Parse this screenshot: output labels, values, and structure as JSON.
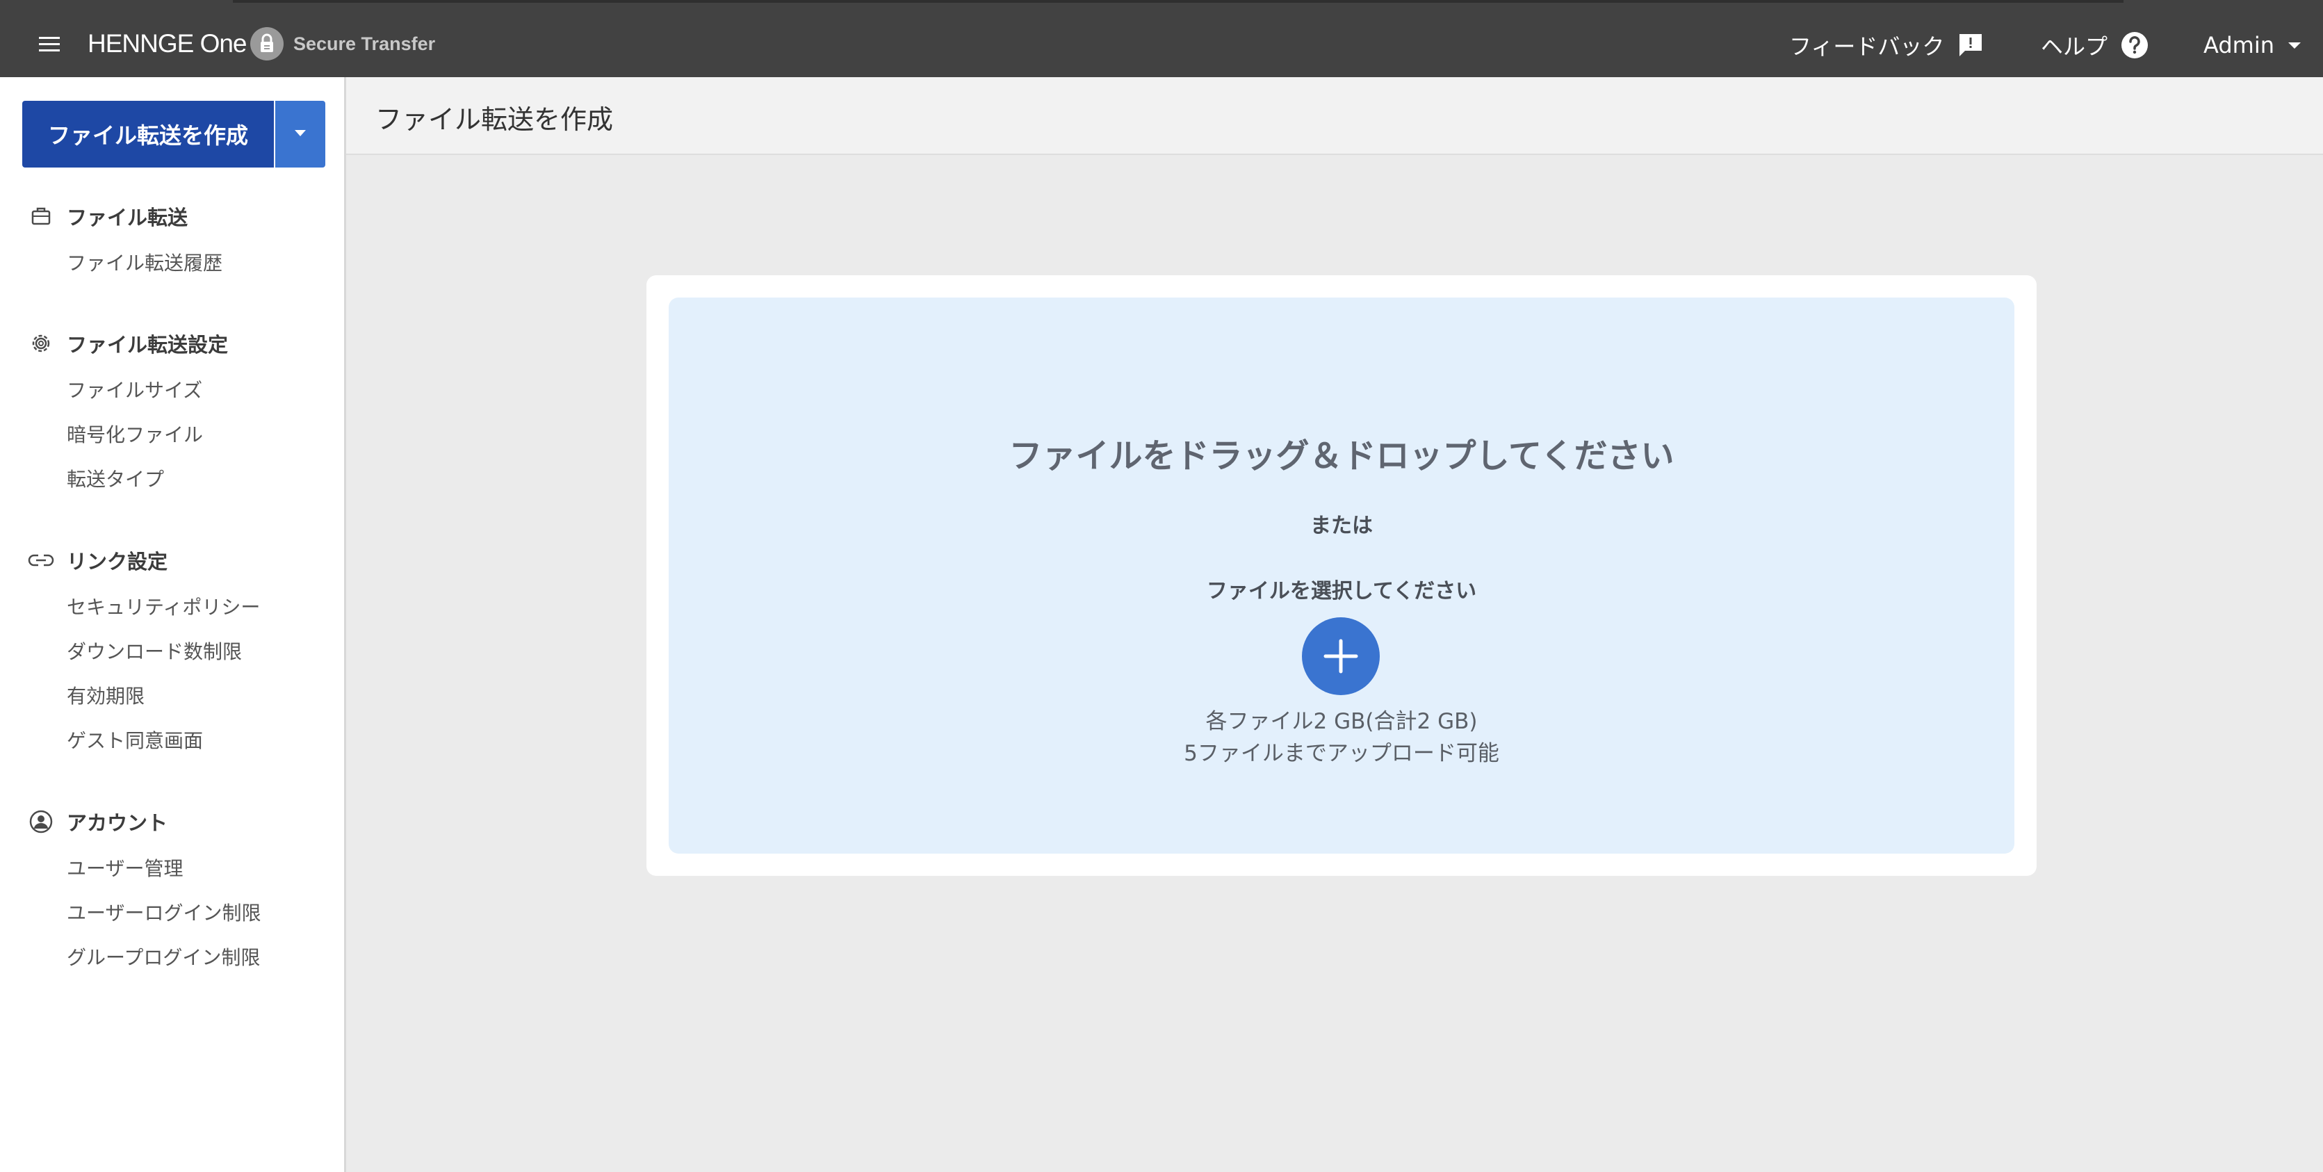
{
  "header": {
    "logo_text": "HENNGE One",
    "product_name": "Secure Transfer",
    "feedback_label": "フィードバック",
    "help_label": "ヘルプ",
    "user_label": "Admin"
  },
  "sidebar": {
    "create_button_label": "ファイル転送を作成",
    "sections": [
      {
        "title": "ファイル転送",
        "icon": "briefcase-icon",
        "items": [
          "ファイル転送履歴"
        ]
      },
      {
        "title": "ファイル転送設定",
        "icon": "gear-icon",
        "items": [
          "ファイルサイズ",
          "暗号化ファイル",
          "転送タイプ"
        ]
      },
      {
        "title": "リンク設定",
        "icon": "link-icon",
        "items": [
          "セキュリティポリシー",
          "ダウンロード数制限",
          "有効期限",
          "ゲスト同意画面"
        ]
      },
      {
        "title": "アカウント",
        "icon": "account-circle-icon",
        "items": [
          "ユーザー管理",
          "ユーザーログイン制限",
          "グループログイン制限"
        ]
      }
    ]
  },
  "main": {
    "page_title": "ファイル転送を作成",
    "dropzone": {
      "title": "ファイルをドラッグ＆ドロップしてください",
      "or_text": "または",
      "select_text": "ファイルを選択してください",
      "limit_size": "各ファイル2 GB(合計2 GB)",
      "limit_count": "5ファイルまでアップロード可能"
    }
  },
  "colors": {
    "topbar": "#424242",
    "primary_button": "#1e48a5",
    "accent_blue": "#3a74d0",
    "dropzone_bg": "#e3f0fc",
    "page_bg": "#ebebeb"
  }
}
